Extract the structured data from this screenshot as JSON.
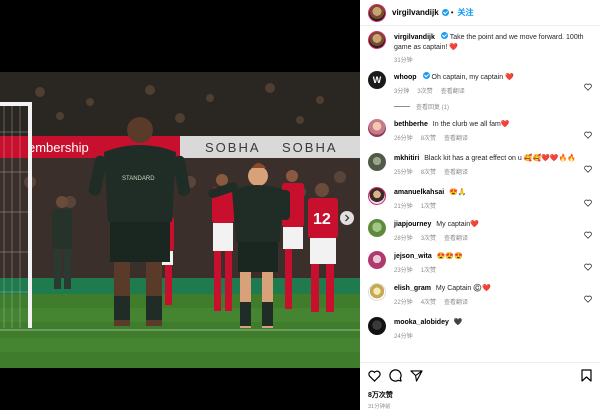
{
  "post": {
    "author": "virgilvandijk",
    "follow_label": "关注",
    "caption": "Take the point and we move forward. 100th game as captain! ❤️",
    "caption_time": "31分钟",
    "translate_label": "查看翻译",
    "likes": "8万次赞",
    "post_time": "31分钟前"
  },
  "comments": [
    {
      "user": "whoop",
      "verified": true,
      "text": "Oh captain, my captain ❤️",
      "time": "3分钟",
      "likes": "3次赞",
      "replies": "查看回复 (1)"
    },
    {
      "user": "bethberhe",
      "verified": false,
      "text": "In the clurb we all fam❤️",
      "time": "26分钟",
      "likes": "8次赞"
    },
    {
      "user": "mkhitiri",
      "verified": false,
      "text": "Black kit has a great effect on u 🥰🥰❤️❤️🔥🔥",
      "time": "25分钟",
      "likes": "8次赞"
    },
    {
      "user": "amanuelkahsai",
      "verified": false,
      "text": "😍🙏",
      "time": "21分钟",
      "likes": "1次赞"
    },
    {
      "user": "jiapjourney",
      "verified": false,
      "text": "My captain❤️",
      "time": "28分钟",
      "likes": "3次赞"
    },
    {
      "user": "jejson_wita",
      "verified": false,
      "text": "😍😍😍",
      "time": "23分钟",
      "likes": "1次赞"
    },
    {
      "user": "elish_gram",
      "verified": false,
      "text": "My Captain ©️❤️",
      "time": "22分钟",
      "likes": "4次赞"
    },
    {
      "user": "mooka_alobidey",
      "verified": false,
      "text": "🖤",
      "time": "24分钟",
      "likes": ""
    }
  ],
  "banner": {
    "left": "embership",
    "mid": "SOBHA",
    "right": "SOBHA"
  },
  "colors": {
    "accent": "#0095f6",
    "verified": "#1d9bf0",
    "heart": "#ed4956",
    "muted": "#8e8e8e"
  },
  "icons": [
    "heart-icon",
    "comment-icon",
    "share-icon",
    "bookmark-icon",
    "verified-icon",
    "chevron-right-icon"
  ]
}
